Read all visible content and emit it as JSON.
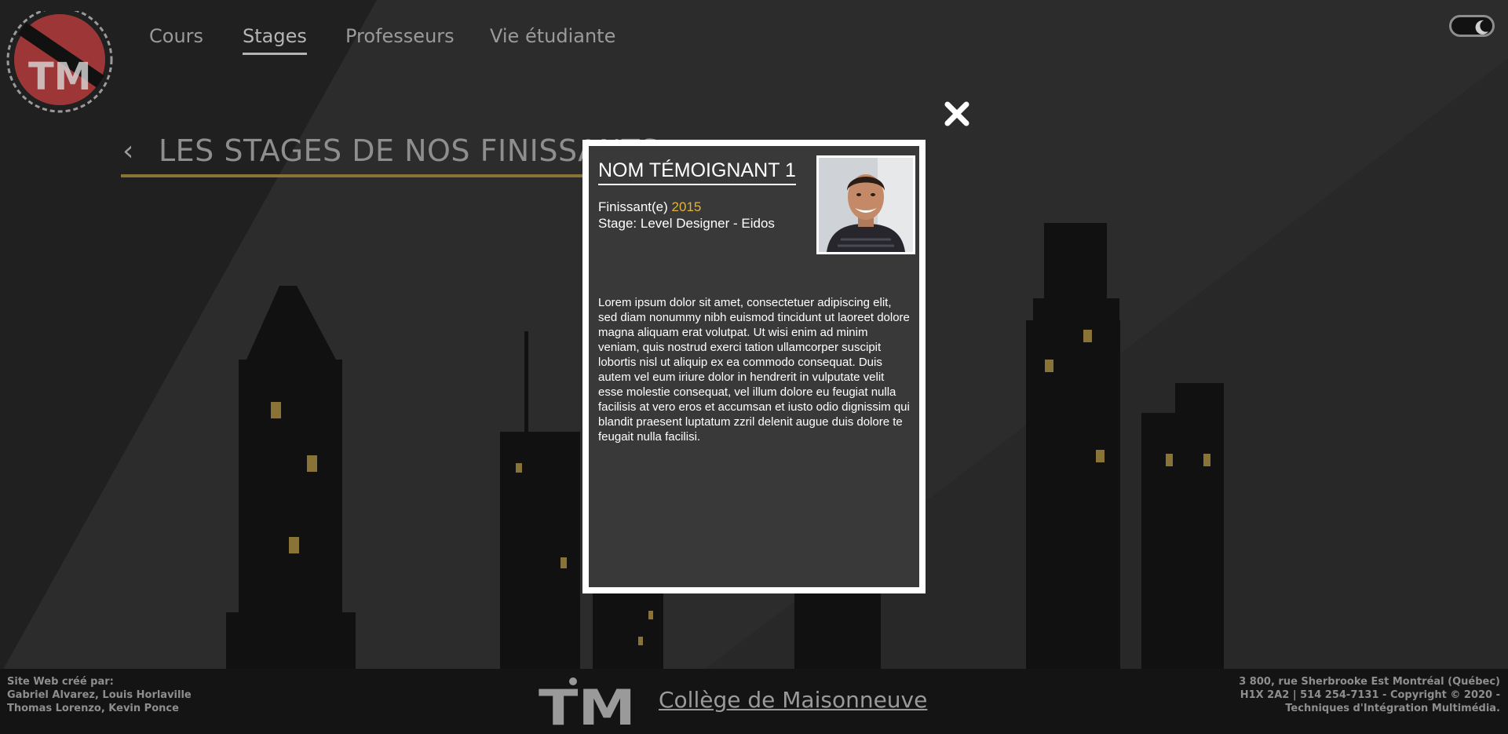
{
  "nav": {
    "items": [
      {
        "label": "Cours"
      },
      {
        "label": "Stages"
      },
      {
        "label": "Professeurs"
      },
      {
        "label": "Vie étudiante"
      }
    ],
    "active": "Stages"
  },
  "logo": {
    "text": "TM"
  },
  "page": {
    "back_symbol": "‹",
    "title": "LES STAGES DE NOS FINISSANTS"
  },
  "modal": {
    "name": "NOM TÉMOIGNANT 1",
    "grad_label": "Finissant(e)",
    "grad_year": "2015",
    "stage": "Stage: Level Designer - Eidos",
    "body": "Lorem ipsum dolor sit amet, consectetuer adipiscing elit, sed diam nonummy nibh euismod tincidunt ut laoreet dolore magna aliquam erat volutpat. Ut wisi enim ad minim veniam, quis nostrud exerci tation ullamcorper suscipit lobortis nisl ut aliquip ex ea commodo consequat. Duis autem vel eum iriure dolor in hendrerit in vulputate velit esse molestie consequat, vel illum dolore eu feugiat nulla facilisis at vero eros et accumsan et iusto odio dignissim qui blandit praesent luptatum zzril delenit augue duis dolore te feugait nulla facilisi."
  },
  "footer": {
    "credits_title": "Site Web créé par:",
    "credits_line1": "Gabriel Alvarez, Louis Horlaville",
    "credits_line2": "Thomas Lorenzo, Kevin Ponce",
    "logo_text": "TM",
    "college_link": "Collège de Maisonneuve",
    "address_line1": "3 800, rue Sherbrooke Est Montréal (Québec)",
    "address_line2": "H1X 2A2 | 514 254-7131 - Copyright © 2020 -",
    "address_line3": "Techniques d'Intégration Multimédia."
  },
  "colors": {
    "accent_gold": "#e1b43a",
    "heading_underline": "#8a7337",
    "logo_red": "#b43c3c",
    "background": "#222222"
  }
}
